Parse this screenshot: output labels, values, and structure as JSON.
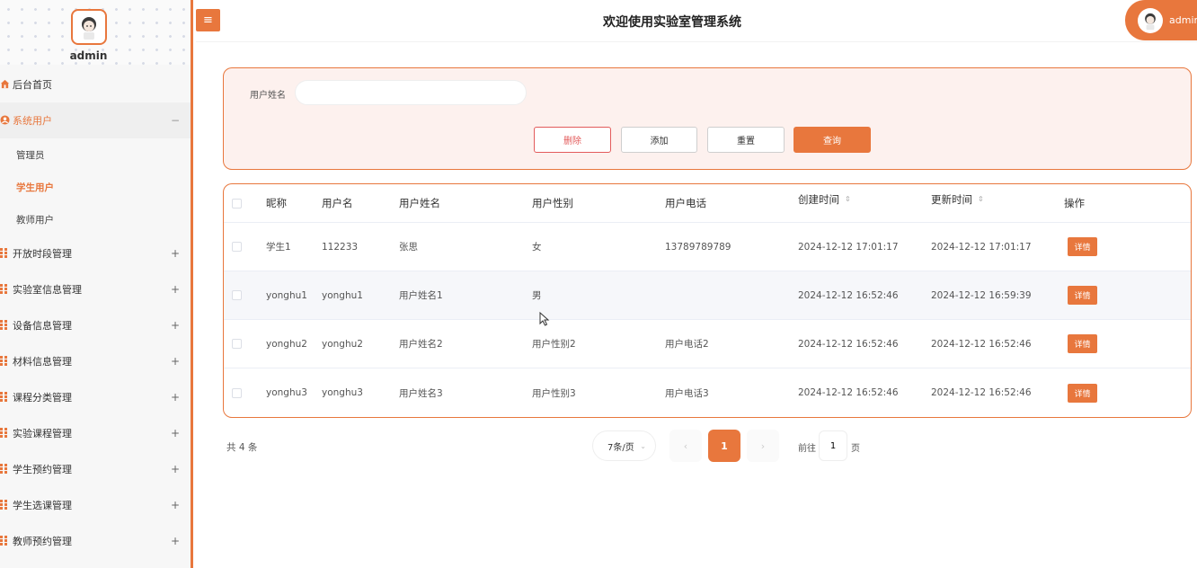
{
  "sidebar": {
    "admin_name": "admin",
    "items": [
      {
        "label": "后台首页",
        "icon": "home-icon"
      },
      {
        "label": "系统用户",
        "icon": "user-circle-icon",
        "sign": "−",
        "expanded": true,
        "children": [
          {
            "label": "管理员"
          },
          {
            "label": "学生用户"
          },
          {
            "label": "教师用户"
          }
        ]
      },
      {
        "label": "开放时段管理",
        "icon": "grid-icon",
        "sign": "+"
      },
      {
        "label": "实验室信息管理",
        "icon": "grid-icon",
        "sign": "+"
      },
      {
        "label": "设备信息管理",
        "icon": "grid-icon",
        "sign": "+"
      },
      {
        "label": "材料信息管理",
        "icon": "grid-icon",
        "sign": "+"
      },
      {
        "label": "课程分类管理",
        "icon": "grid-icon",
        "sign": "+"
      },
      {
        "label": "实验课程管理",
        "icon": "grid-icon",
        "sign": "+"
      },
      {
        "label": "学生预约管理",
        "icon": "grid-icon",
        "sign": "+"
      },
      {
        "label": "学生选课管理",
        "icon": "grid-icon",
        "sign": "+"
      },
      {
        "label": "教师预约管理",
        "icon": "grid-icon",
        "sign": "+"
      }
    ]
  },
  "header": {
    "menu_toggle": "≡",
    "title": "欢迎使用实验室管理系统",
    "user": "admin"
  },
  "search": {
    "label": "用户姓名",
    "value": "",
    "placeholder": "",
    "buttons": {
      "delete": "删除",
      "add": "添加",
      "reset": "重置",
      "query": "查询"
    }
  },
  "table": {
    "columns": {
      "nickname": "昵称",
      "username": "用户名",
      "realname": "用户姓名",
      "gender": "用户性别",
      "phone": "用户电话",
      "created": "创建时间",
      "updated": "更新时间",
      "action": "操作"
    },
    "sort_glyph": "⇕",
    "detail_label": "详情",
    "rows": [
      {
        "nickname": "学生1",
        "username": "112233",
        "realname": "张思",
        "gender": "女",
        "phone": "13789789789",
        "created": "2024-12-12 17:01:17",
        "updated": "2024-12-12 17:01:17"
      },
      {
        "nickname": "yonghu1",
        "username": "yonghu1",
        "realname": "用户姓名1",
        "gender": "男",
        "phone": "",
        "created": "2024-12-12 16:52:46",
        "updated": "2024-12-12 16:59:39"
      },
      {
        "nickname": "yonghu2",
        "username": "yonghu2",
        "realname": "用户姓名2",
        "gender": "用户性别2",
        "phone": "用户电话2",
        "created": "2024-12-12 16:52:46",
        "updated": "2024-12-12 16:52:46"
      },
      {
        "nickname": "yonghu3",
        "username": "yonghu3",
        "realname": "用户姓名3",
        "gender": "用户性别3",
        "phone": "用户电话3",
        "created": "2024-12-12 16:52:46",
        "updated": "2024-12-12 16:52:46"
      }
    ]
  },
  "pagination": {
    "total": "共 4 条",
    "page_size": "7条/页",
    "prev": "‹",
    "current": "1",
    "next": "›",
    "goto_label": "前往",
    "goto_value": "1",
    "goto_unit": "页"
  },
  "colors": {
    "accent": "#e8773d",
    "danger": "#e35b5b",
    "panel_bg": "#fdf1ee"
  }
}
